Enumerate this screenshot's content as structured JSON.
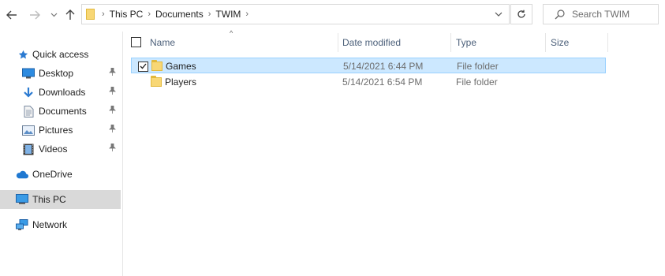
{
  "address_bar": {
    "segments": [
      "This PC",
      "Documents",
      "TWIM"
    ]
  },
  "search": {
    "placeholder": "Search TWIM"
  },
  "sidebar": {
    "items": [
      {
        "label": "Quick access",
        "icon": "star-icon"
      },
      {
        "label": "Desktop",
        "icon": "desktop-icon",
        "pinned": true
      },
      {
        "label": "Downloads",
        "icon": "download-icon",
        "pinned": true
      },
      {
        "label": "Documents",
        "icon": "documents-icon",
        "pinned": true
      },
      {
        "label": "Pictures",
        "icon": "pictures-icon",
        "pinned": true
      },
      {
        "label": "Videos",
        "icon": "videos-icon",
        "pinned": true
      },
      {
        "label": "OneDrive",
        "icon": "cloud-icon"
      },
      {
        "label": "This PC",
        "icon": "computer-icon",
        "selected": true
      },
      {
        "label": "Network",
        "icon": "network-icon"
      }
    ]
  },
  "columns": {
    "name": "Name",
    "date_modified": "Date modified",
    "type": "Type",
    "size": "Size"
  },
  "files": [
    {
      "name": "Games",
      "date_modified": "5/14/2021 6:44 PM",
      "type": "File folder",
      "size": "",
      "selected": true,
      "checked": true
    },
    {
      "name": "Players",
      "date_modified": "5/14/2021 6:54 PM",
      "type": "File folder",
      "size": "",
      "selected": false,
      "checked": false
    }
  ],
  "colors": {
    "selection_bg": "#cce8ff",
    "selection_border": "#99d1ff",
    "header_text": "#4c607a",
    "folder": "#f8d775",
    "sidebar_selected": "#d9d9d9"
  }
}
